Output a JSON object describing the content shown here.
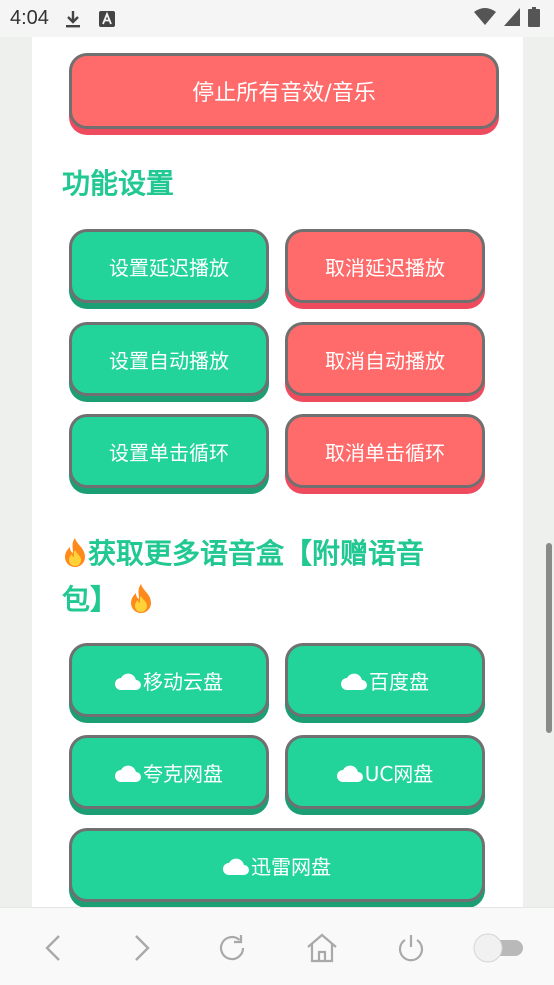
{
  "status_bar": {
    "time": "4:04"
  },
  "top_button": {
    "label": "停止所有音效/音乐"
  },
  "settings": {
    "heading": "功能设置",
    "buttons": [
      {
        "label": "设置延迟播放",
        "color": "#22d39a"
      },
      {
        "label": "取消延迟播放",
        "color": "#ff6b6b"
      },
      {
        "label": "设置自动播放",
        "color": "#22d39a"
      },
      {
        "label": "取消自动播放",
        "color": "#ff6b6b"
      },
      {
        "label": "设置单击循环",
        "color": "#22d39a"
      },
      {
        "label": "取消单击循环",
        "color": "#ff6b6b"
      }
    ]
  },
  "more": {
    "heading_line1": "获取更多语音盒【附赠语音",
    "heading_line2": "包】",
    "buttons": [
      {
        "label": "移动云盘",
        "icon": "cloud-icon"
      },
      {
        "label": "百度盘",
        "icon": "cloud-icon"
      },
      {
        "label": "夸克网盘",
        "icon": "cloud-icon"
      },
      {
        "label": "UC网盘",
        "icon": "cloud-icon"
      },
      {
        "label": "迅雷网盘",
        "icon": "cloud-icon"
      }
    ]
  },
  "navbar": {
    "icons": [
      "back-icon",
      "forward-icon",
      "reload-icon",
      "home-icon",
      "power-icon",
      "toggle-switch"
    ]
  },
  "colors": {
    "accent_green": "#22d39a",
    "accent_red": "#ff6b6b",
    "heading_green": "#22c892"
  }
}
